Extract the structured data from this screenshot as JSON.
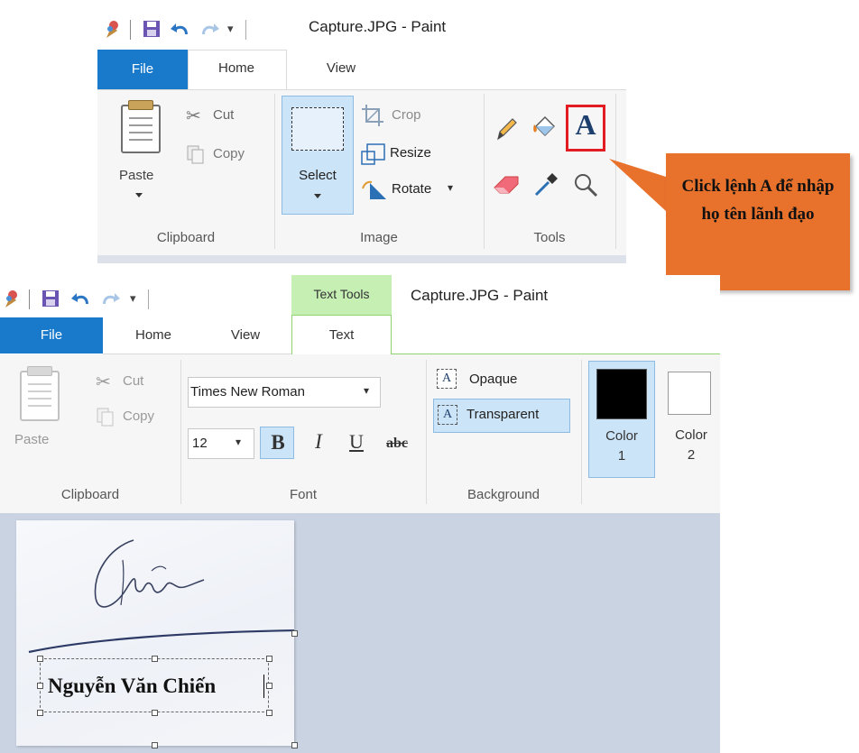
{
  "top": {
    "window_title": "Capture.JPG - Paint",
    "tabs": {
      "file": "File",
      "home": "Home",
      "view": "View"
    },
    "clipboard": {
      "paste": "Paste",
      "cut": "Cut",
      "copy": "Copy",
      "group": "Clipboard"
    },
    "image": {
      "select": "Select",
      "crop": "Crop",
      "resize": "Resize",
      "rotate": "Rotate",
      "group": "Image"
    },
    "tools": {
      "text_tool_glyph": "A",
      "group": "Tools"
    }
  },
  "callout": {
    "text": "Click lệnh A để nhập họ tên lãnh đạo",
    "color": "#e8712c"
  },
  "bottom": {
    "window_title": "Capture.JPG - Paint",
    "context_tab": "Text Tools",
    "tabs": {
      "file": "File",
      "home": "Home",
      "view": "View",
      "text": "Text"
    },
    "clipboard": {
      "paste": "Paste",
      "cut": "Cut",
      "copy": "Copy",
      "group": "Clipboard"
    },
    "font": {
      "family": "Times New Roman",
      "size": "12",
      "bold": "B",
      "italic": "I",
      "underline": "U",
      "strike": "abc",
      "group": "Font"
    },
    "background": {
      "opaque": "Opaque",
      "transparent": "Transparent",
      "group": "Background"
    },
    "colors": {
      "color1": "Color 1",
      "color2": "Color 2",
      "color1_value": "#000000",
      "color2_value": "#ffffff"
    },
    "canvas_text": "Nguyễn Văn Chiến"
  },
  "accent": {
    "file_blue": "#1979ca",
    "context_green": "#c6efb4",
    "highlight_red": "#e31b23",
    "selected_blue": "#cce4f7"
  }
}
